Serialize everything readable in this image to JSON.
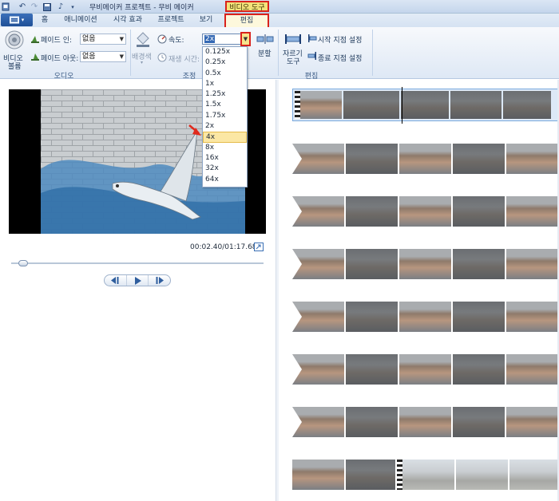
{
  "window": {
    "title": "무비메이커 프로젝트 - 무비 메이커",
    "context_header": "비디오 도구"
  },
  "ribbon_tabs": {
    "file_label": "▾",
    "home": "홈",
    "animation": "애니메이션",
    "visual_effects": "시각 효과",
    "project": "프로젝트",
    "view": "보기",
    "edit": "편집"
  },
  "audio_group": {
    "video_volume": "비디오\n볼륨",
    "video_volume_line1": "비디오",
    "video_volume_line2": "볼륨",
    "fade_in_label": "페이드 인:",
    "fade_in_value": "없음",
    "fade_out_label": "페이드 아웃:",
    "fade_out_value": "없음",
    "group_label": "오디오"
  },
  "adjust_group": {
    "background_color": "배경색",
    "speed_label": "속도:",
    "speed_value": "2x",
    "duration_label": "재생 시간:",
    "group_label": "조정"
  },
  "edit_group": {
    "split": "분할",
    "trim_tool_line1": "자르기",
    "trim_tool_line2": "도구",
    "set_start": "시작 지점 설정",
    "set_end": "종료 지점 설정",
    "group_label": "편집"
  },
  "speed_options": [
    "0.125x",
    "0.25x",
    "0.5x",
    "1x",
    "1.25x",
    "1.5x",
    "1.75x",
    "2x",
    "4x",
    "8x",
    "16x",
    "32x",
    "64x"
  ],
  "speed_selected": "4x",
  "player": {
    "time": "00:02.40/01:17.68",
    "seek_position": 0.03
  },
  "colors": {
    "highlight_red": "#d9221c",
    "context_yellow": "#f3e27a",
    "selected_option": "#fbe7a4"
  }
}
